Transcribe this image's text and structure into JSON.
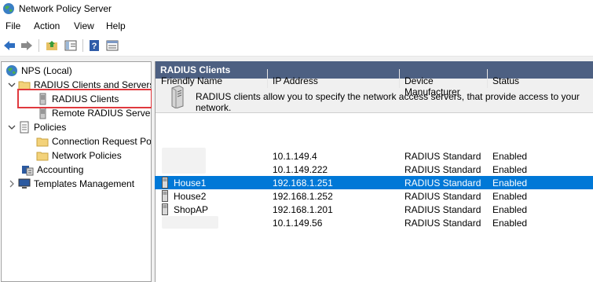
{
  "window": {
    "title": "Network Policy Server",
    "app_icon": "globe-icon"
  },
  "menu": {
    "items": [
      "File",
      "Action",
      "View",
      "Help"
    ]
  },
  "toolbar": {
    "buttons": [
      "back-arrow-icon",
      "forward-arrow-icon",
      "up-folder-icon",
      "show-hide-tree-icon",
      "help-icon",
      "properties-icon"
    ]
  },
  "tree": {
    "items": [
      {
        "label": "NPS (Local)",
        "icon": "globe-icon",
        "expander": ""
      },
      {
        "label": "RADIUS Clients and Servers",
        "icon": "folder-icon",
        "expander": "expanded"
      },
      {
        "label": "RADIUS Clients",
        "icon": "server-icon",
        "expander": ""
      },
      {
        "label": "Remote RADIUS Server",
        "icon": "server-icon",
        "expander": ""
      },
      {
        "label": "Policies",
        "icon": "document-icon",
        "expander": "expanded"
      },
      {
        "label": "Connection Request Po",
        "icon": "folder-icon",
        "expander": ""
      },
      {
        "label": "Network Policies",
        "icon": "folder-icon",
        "expander": ""
      },
      {
        "label": "Accounting",
        "icon": "accounting-icon",
        "expander": ""
      },
      {
        "label": "Templates Management",
        "icon": "computer-icon",
        "expander": "collapsed"
      }
    ]
  },
  "content": {
    "header": "RADIUS Clients",
    "description": "RADIUS clients allow you to specify the network access servers, that provide access to your network."
  },
  "table": {
    "columns": [
      "Friendly Name",
      "IP Address",
      "Device Manufacturer",
      "Status"
    ],
    "rows": [
      {
        "name": "",
        "ip": "10.1.149.4",
        "manufacturer": "RADIUS Standard",
        "status": "Enabled",
        "redacted": true
      },
      {
        "name": "",
        "ip": "10.1.149.222",
        "manufacturer": "RADIUS Standard",
        "status": "Enabled",
        "redacted": true
      },
      {
        "name": "House1",
        "ip": "192.168.1.251",
        "manufacturer": "RADIUS Standard",
        "status": "Enabled",
        "selected": true
      },
      {
        "name": "House2",
        "ip": "192.168.1.252",
        "manufacturer": "RADIUS Standard",
        "status": "Enabled"
      },
      {
        "name": "ShopAP",
        "ip": "192.168.1.201",
        "manufacturer": "RADIUS Standard",
        "status": "Enabled"
      },
      {
        "name": "",
        "ip": "10.1.149.56",
        "manufacturer": "RADIUS Standard",
        "status": "Enabled",
        "redacted": true
      }
    ]
  },
  "colors": {
    "header_bar": "#4d6082",
    "selection": "#0078d7",
    "highlight_box": "#e0393e"
  }
}
